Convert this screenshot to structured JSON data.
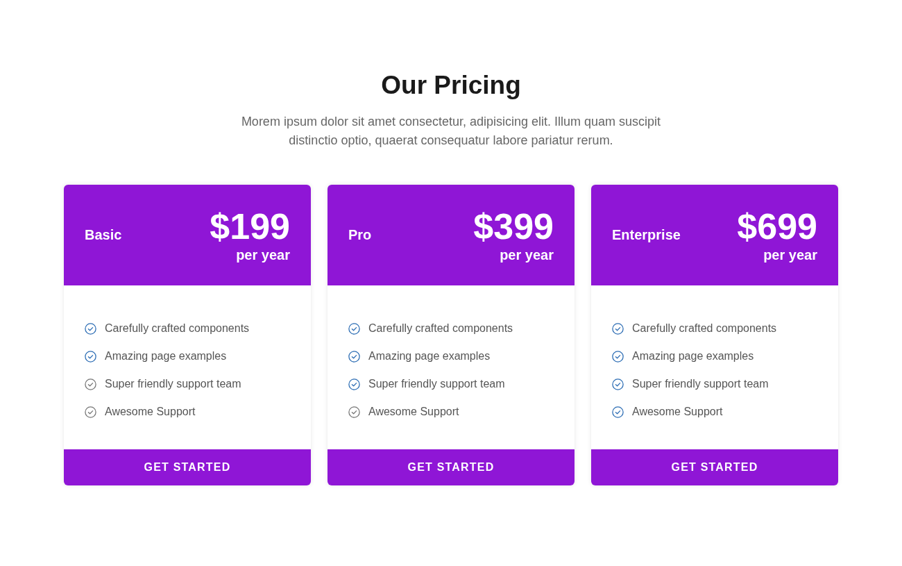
{
  "heading": {
    "title": "Our Pricing",
    "subtitle": "Morem ipsum dolor sit amet consectetur, adipisicing elit. Illum quam suscipit distinctio optio, quaerat consequatur labore pariatur rerum."
  },
  "plans": [
    {
      "name": "Basic",
      "price": "$199",
      "period": "per year",
      "button": "GET STARTED",
      "features": [
        {
          "label": "Carefully crafted components",
          "included": true
        },
        {
          "label": "Amazing page examples",
          "included": true
        },
        {
          "label": "Super friendly support team",
          "included": false
        },
        {
          "label": "Awesome Support",
          "included": false
        }
      ]
    },
    {
      "name": "Pro",
      "price": "$399",
      "period": "per year",
      "button": "GET STARTED",
      "features": [
        {
          "label": "Carefully crafted components",
          "included": true
        },
        {
          "label": "Amazing page examples",
          "included": true
        },
        {
          "label": "Super friendly support team",
          "included": true
        },
        {
          "label": "Awesome Support",
          "included": false
        }
      ]
    },
    {
      "name": "Enterprise",
      "price": "$699",
      "period": "per year",
      "button": "GET STARTED",
      "features": [
        {
          "label": "Carefully crafted components",
          "included": true
        },
        {
          "label": "Amazing page examples",
          "included": true
        },
        {
          "label": "Super friendly support team",
          "included": true
        },
        {
          "label": "Awesome Support",
          "included": true
        }
      ]
    }
  ]
}
